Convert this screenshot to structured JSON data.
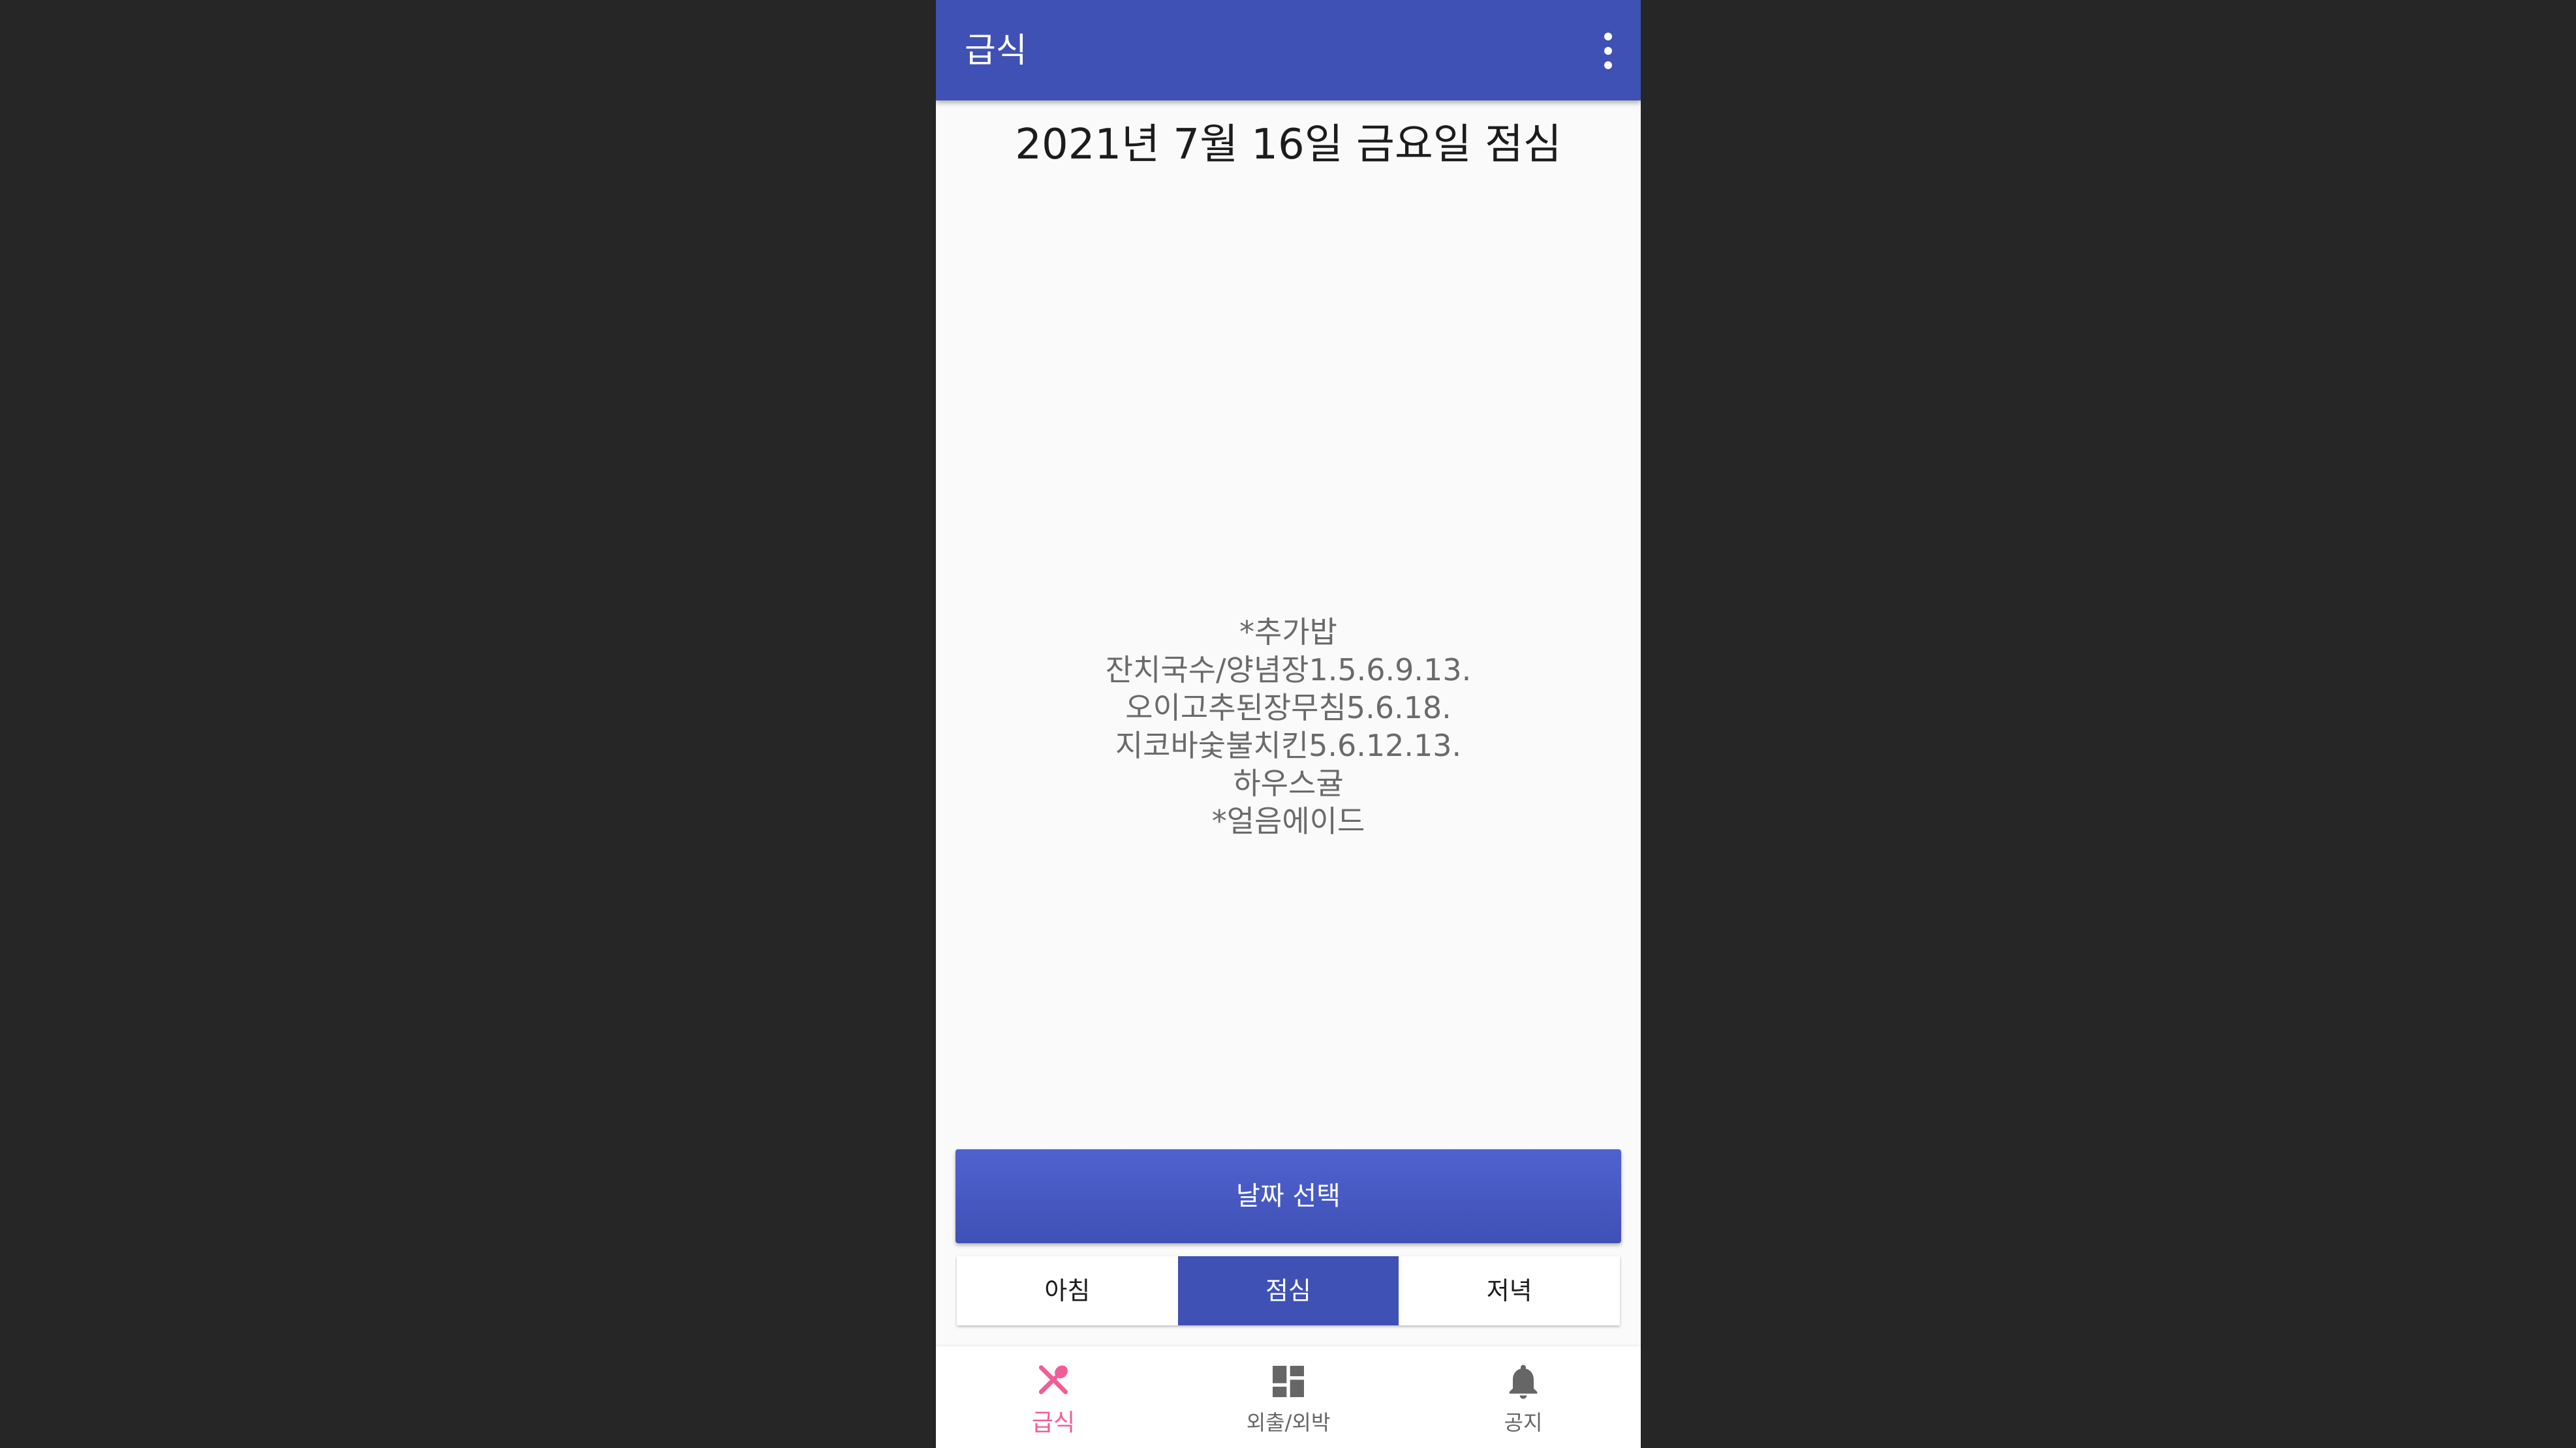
{
  "app_bar": {
    "title": "급식",
    "overflow_icon": "more-vert-icon"
  },
  "meal": {
    "heading": "2021년 7월 16일 금요일 점심",
    "menu_items": [
      "*추가밥",
      "잔치국수/양념장1.5.6.9.13.",
      "오이고추된장무침5.6.18.",
      "지코바숯불치킨5.6.12.13.",
      "하우스귤",
      "*얼음에이드"
    ]
  },
  "date_button": {
    "label": "날짜 선택"
  },
  "meal_tabs": [
    {
      "label": "아침",
      "active": false
    },
    {
      "label": "점심",
      "active": true
    },
    {
      "label": "저녁",
      "active": false
    }
  ],
  "bottom_nav": [
    {
      "label": "급식",
      "icon": "fork-spoon-icon",
      "active": true
    },
    {
      "label": "외출/외박",
      "icon": "dashboard-icon",
      "active": false
    },
    {
      "label": "공지",
      "icon": "bell-icon",
      "active": false
    }
  ],
  "colors": {
    "primary": "#3f51b5",
    "accent": "#f25d98",
    "background": "#fafafa",
    "outer": "#262626"
  }
}
